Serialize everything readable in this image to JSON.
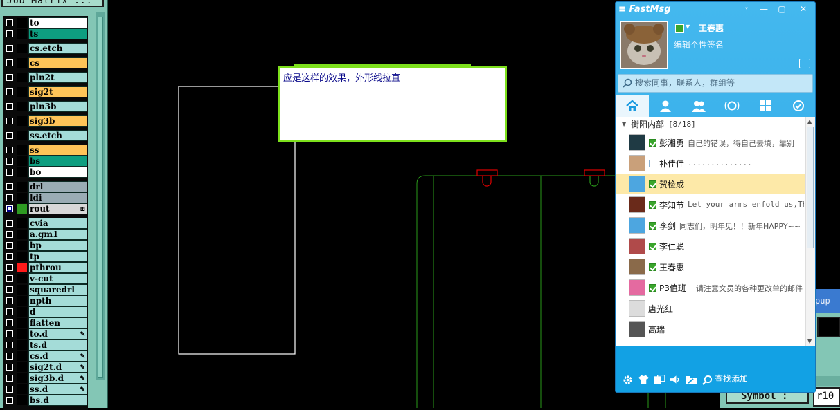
{
  "layer_panel": {
    "title": "Job Matrix ...",
    "layers": [
      {
        "name": "to",
        "bg": "#ffffff",
        "chip": "#000000",
        "sep_before": false
      },
      {
        "name": "ts",
        "bg": "#0e9e80",
        "chip": "#000000",
        "sep_before": false
      },
      {
        "name": "cs.etch",
        "bg": "#a4dcd8",
        "chip": "#000000",
        "sep_before": true
      },
      {
        "name": "cs",
        "bg": "#ffc458",
        "chip": "#000000",
        "sep_before": true
      },
      {
        "name": "pln2t",
        "bg": "#a4dcd8",
        "chip": "#000000",
        "sep_before": true
      },
      {
        "name": "sig2t",
        "bg": "#ffc458",
        "chip": "#000000",
        "sep_before": true
      },
      {
        "name": "pln3b",
        "bg": "#a4dcd8",
        "chip": "#000000",
        "sep_before": true
      },
      {
        "name": "sig3b",
        "bg": "#ffc458",
        "chip": "#000000",
        "sep_before": true
      },
      {
        "name": "ss.etch",
        "bg": "#a4dcd8",
        "chip": "#000000",
        "sep_before": true
      },
      {
        "name": "ss",
        "bg": "#ffc458",
        "chip": "#000000",
        "sep_before": true
      },
      {
        "name": "bs",
        "bg": "#0e9e80",
        "chip": "#000000",
        "sep_before": false
      },
      {
        "name": "bo",
        "bg": "#ffffff",
        "chip": "#000000",
        "sep_before": false
      },
      {
        "name": "drl",
        "bg": "#9aacb4",
        "chip": "#000000",
        "sep_before": true
      },
      {
        "name": "ldi",
        "bg": "#9aacb4",
        "chip": "#000000",
        "sep_before": false
      },
      {
        "name": "rout",
        "bg": "#d8d8d8",
        "chip": "#2e9a22",
        "sep_before": false,
        "selected": true,
        "flag": "⊞"
      },
      {
        "name": "cvia",
        "bg": "#a4dcd8",
        "chip": "#000000",
        "sep_before": true
      },
      {
        "name": "a.gm1",
        "bg": "#a4dcd8",
        "chip": "#000000",
        "sep_before": false
      },
      {
        "name": "bp",
        "bg": "#a4dcd8",
        "chip": "#000000",
        "sep_before": false
      },
      {
        "name": "tp",
        "bg": "#a4dcd8",
        "chip": "#000000",
        "sep_before": false
      },
      {
        "name": "pthrou",
        "bg": "#a4dcd8",
        "chip": "#ff1a1a",
        "sep_before": false
      },
      {
        "name": "v-cut",
        "bg": "#a4dcd8",
        "chip": "#000000",
        "sep_before": false
      },
      {
        "name": "squaredrl",
        "bg": "#a4dcd8",
        "chip": "#000000",
        "sep_before": false
      },
      {
        "name": "npth",
        "bg": "#a4dcd8",
        "chip": "#000000",
        "sep_before": false
      },
      {
        "name": "d",
        "bg": "#a4dcd8",
        "chip": "#000000",
        "sep_before": false
      },
      {
        "name": "flatten",
        "bg": "#a4dcd8",
        "chip": "#000000",
        "sep_before": false
      },
      {
        "name": "to.d",
        "bg": "#a4dcd8",
        "chip": "#000000",
        "sep_before": false,
        "flag": "✎"
      },
      {
        "name": "ts.d",
        "bg": "#a4dcd8",
        "chip": "#000000",
        "sep_before": false
      },
      {
        "name": "cs.d",
        "bg": "#a4dcd8",
        "chip": "#000000",
        "sep_before": false,
        "flag": "✎"
      },
      {
        "name": "sig2t.d",
        "bg": "#a4dcd8",
        "chip": "#000000",
        "sep_before": false,
        "flag": "✎"
      },
      {
        "name": "sig3b.d",
        "bg": "#a4dcd8",
        "chip": "#000000",
        "sep_before": false,
        "flag": "✎"
      },
      {
        "name": "ss.d",
        "bg": "#a4dcd8",
        "chip": "#000000",
        "sep_before": false,
        "flag": "✎"
      },
      {
        "name": "bs.d",
        "bg": "#a4dcd8",
        "chip": "#000000",
        "sep_before": false
      }
    ]
  },
  "note": {
    "text": "应是这样的效果，外形线拉直"
  },
  "bg_window": {
    "title_fragment": "pup",
    "symbol_label": "Symbol :",
    "symbol_value": "r10"
  },
  "fastmsg": {
    "app_name": "FastMsg",
    "window_buttons": {
      "menu": "⩡",
      "minimize": "—",
      "maximize": "▢",
      "close": "✕"
    },
    "username": "王春惠",
    "signature": "编辑个性签名",
    "search_placeholder": "搜索同事，联系人，群组等",
    "tabs": [
      "home-icon",
      "contact-icon",
      "group-icon",
      "broadcast-icon",
      "apps-icon",
      "history-icon"
    ],
    "group": {
      "name": "衡阳内部",
      "count": "[8/18]"
    },
    "contacts": [
      {
        "name": "彭湘勇",
        "status": "online",
        "message": "自己的错误，得自己去填，靠别",
        "avatar": "#1f3a44",
        "highlight": false
      },
      {
        "name": "补佳佳",
        "status": "away",
        "message": "..............",
        "avatar": "#c9a07a",
        "highlight": false
      },
      {
        "name": "贺检成",
        "status": "online",
        "message": "",
        "avatar": "#4da6e0",
        "highlight": true
      },
      {
        "name": "李知节",
        "status": "online",
        "message": "Let your arms enfold us,Thro",
        "avatar": "#6a2a1a",
        "highlight": false
      },
      {
        "name": "李剑",
        "status": "online",
        "message": "同志们，明年见！！新年HAPPY~~",
        "avatar": "#4da6e0",
        "highlight": false
      },
      {
        "name": "李仁聪",
        "status": "online",
        "message": "",
        "avatar": "#b04a4a",
        "highlight": false
      },
      {
        "name": "王春惠",
        "status": "online",
        "message": "",
        "avatar": "#8a6a4a",
        "highlight": false
      },
      {
        "name": "P3值班",
        "status": "online",
        "message": "请注意文员的各种更改单的邮件",
        "avatar": "#e46aa0",
        "highlight": false
      },
      {
        "name": "唐光红",
        "status": "none",
        "message": "",
        "avatar": "#dcdcdc",
        "highlight": false
      },
      {
        "name": "高瑞",
        "status": "none",
        "message": "",
        "avatar": "#555555",
        "highlight": false
      }
    ],
    "footer": {
      "add_label": "查找添加"
    }
  }
}
